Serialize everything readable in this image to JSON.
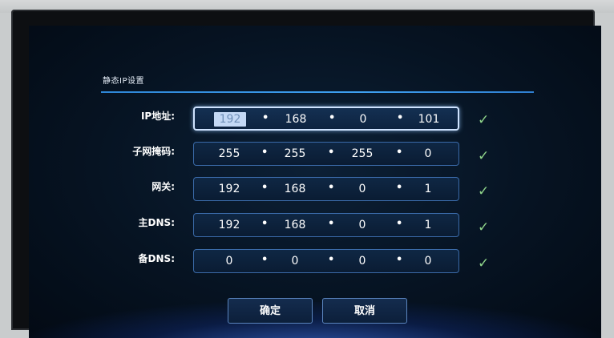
{
  "dialog": {
    "title": "静态IP设置"
  },
  "rows": [
    {
      "label": "IP地址:",
      "octets": [
        "192",
        "168",
        "0",
        "101"
      ],
      "status": "✓",
      "focused": true
    },
    {
      "label": "子网掩码:",
      "octets": [
        "255",
        "255",
        "255",
        "0"
      ],
      "status": "✓"
    },
    {
      "label": "网关:",
      "octets": [
        "192",
        "168",
        "0",
        "1"
      ],
      "status": "✓"
    },
    {
      "label": "主DNS:",
      "octets": [
        "192",
        "168",
        "0",
        "1"
      ],
      "status": "✓"
    },
    {
      "label": "备DNS:",
      "octets": [
        "0",
        "0",
        "0",
        "0"
      ],
      "status": "✓"
    }
  ],
  "separator": "•",
  "buttons": {
    "confirm": "确定",
    "cancel": "取消"
  },
  "colors": {
    "accent": "#3fa0f0",
    "check": "#8fd48a",
    "focus_border": "#cfe3ff"
  }
}
